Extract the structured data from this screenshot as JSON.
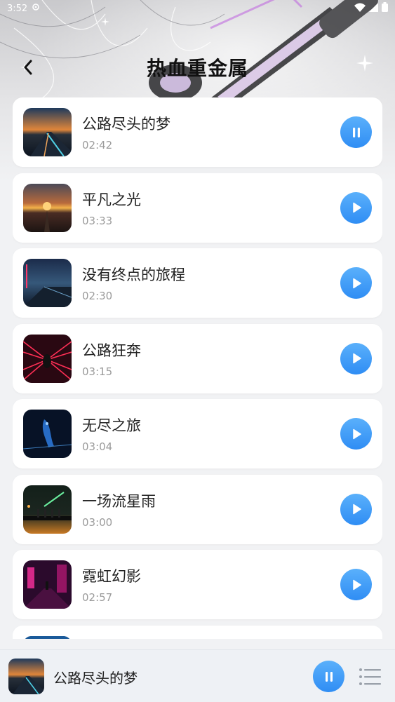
{
  "status_bar": {
    "time": "3:52",
    "icons": [
      "settings-icon",
      "wifi-icon",
      "signal-icon",
      "battery-icon"
    ]
  },
  "header": {
    "title": "热血重金属",
    "back_icon": "back-arrow-icon"
  },
  "songs": [
    {
      "title": "公路尽头的梦",
      "duration": "02:42",
      "state": "pause",
      "art": "highway-dusk"
    },
    {
      "title": "平凡之光",
      "duration": "03:33",
      "state": "play",
      "art": "sunset-road"
    },
    {
      "title": "没有终点的旅程",
      "duration": "02:30",
      "state": "play",
      "art": "neon-night"
    },
    {
      "title": "公路狂奔",
      "duration": "03:15",
      "state": "play",
      "art": "red-tunnel"
    },
    {
      "title": "无尽之旅",
      "duration": "03:04",
      "state": "play",
      "art": "blue-glow"
    },
    {
      "title": "一场流星雨",
      "duration": "03:00",
      "state": "play",
      "art": "meteor"
    },
    {
      "title": "霓虹幻影",
      "duration": "02:57",
      "state": "play",
      "art": "neon-alley"
    },
    {
      "title": "",
      "duration": "",
      "state": "play",
      "art": "partial"
    }
  ],
  "now_playing": {
    "title": "公路尽头的梦",
    "state": "pause",
    "playlist_icon": "playlist-icon"
  },
  "colors": {
    "accent": "#2f8df4",
    "accent_light": "#5ab0fb",
    "duration_text": "#9b9b9b"
  }
}
